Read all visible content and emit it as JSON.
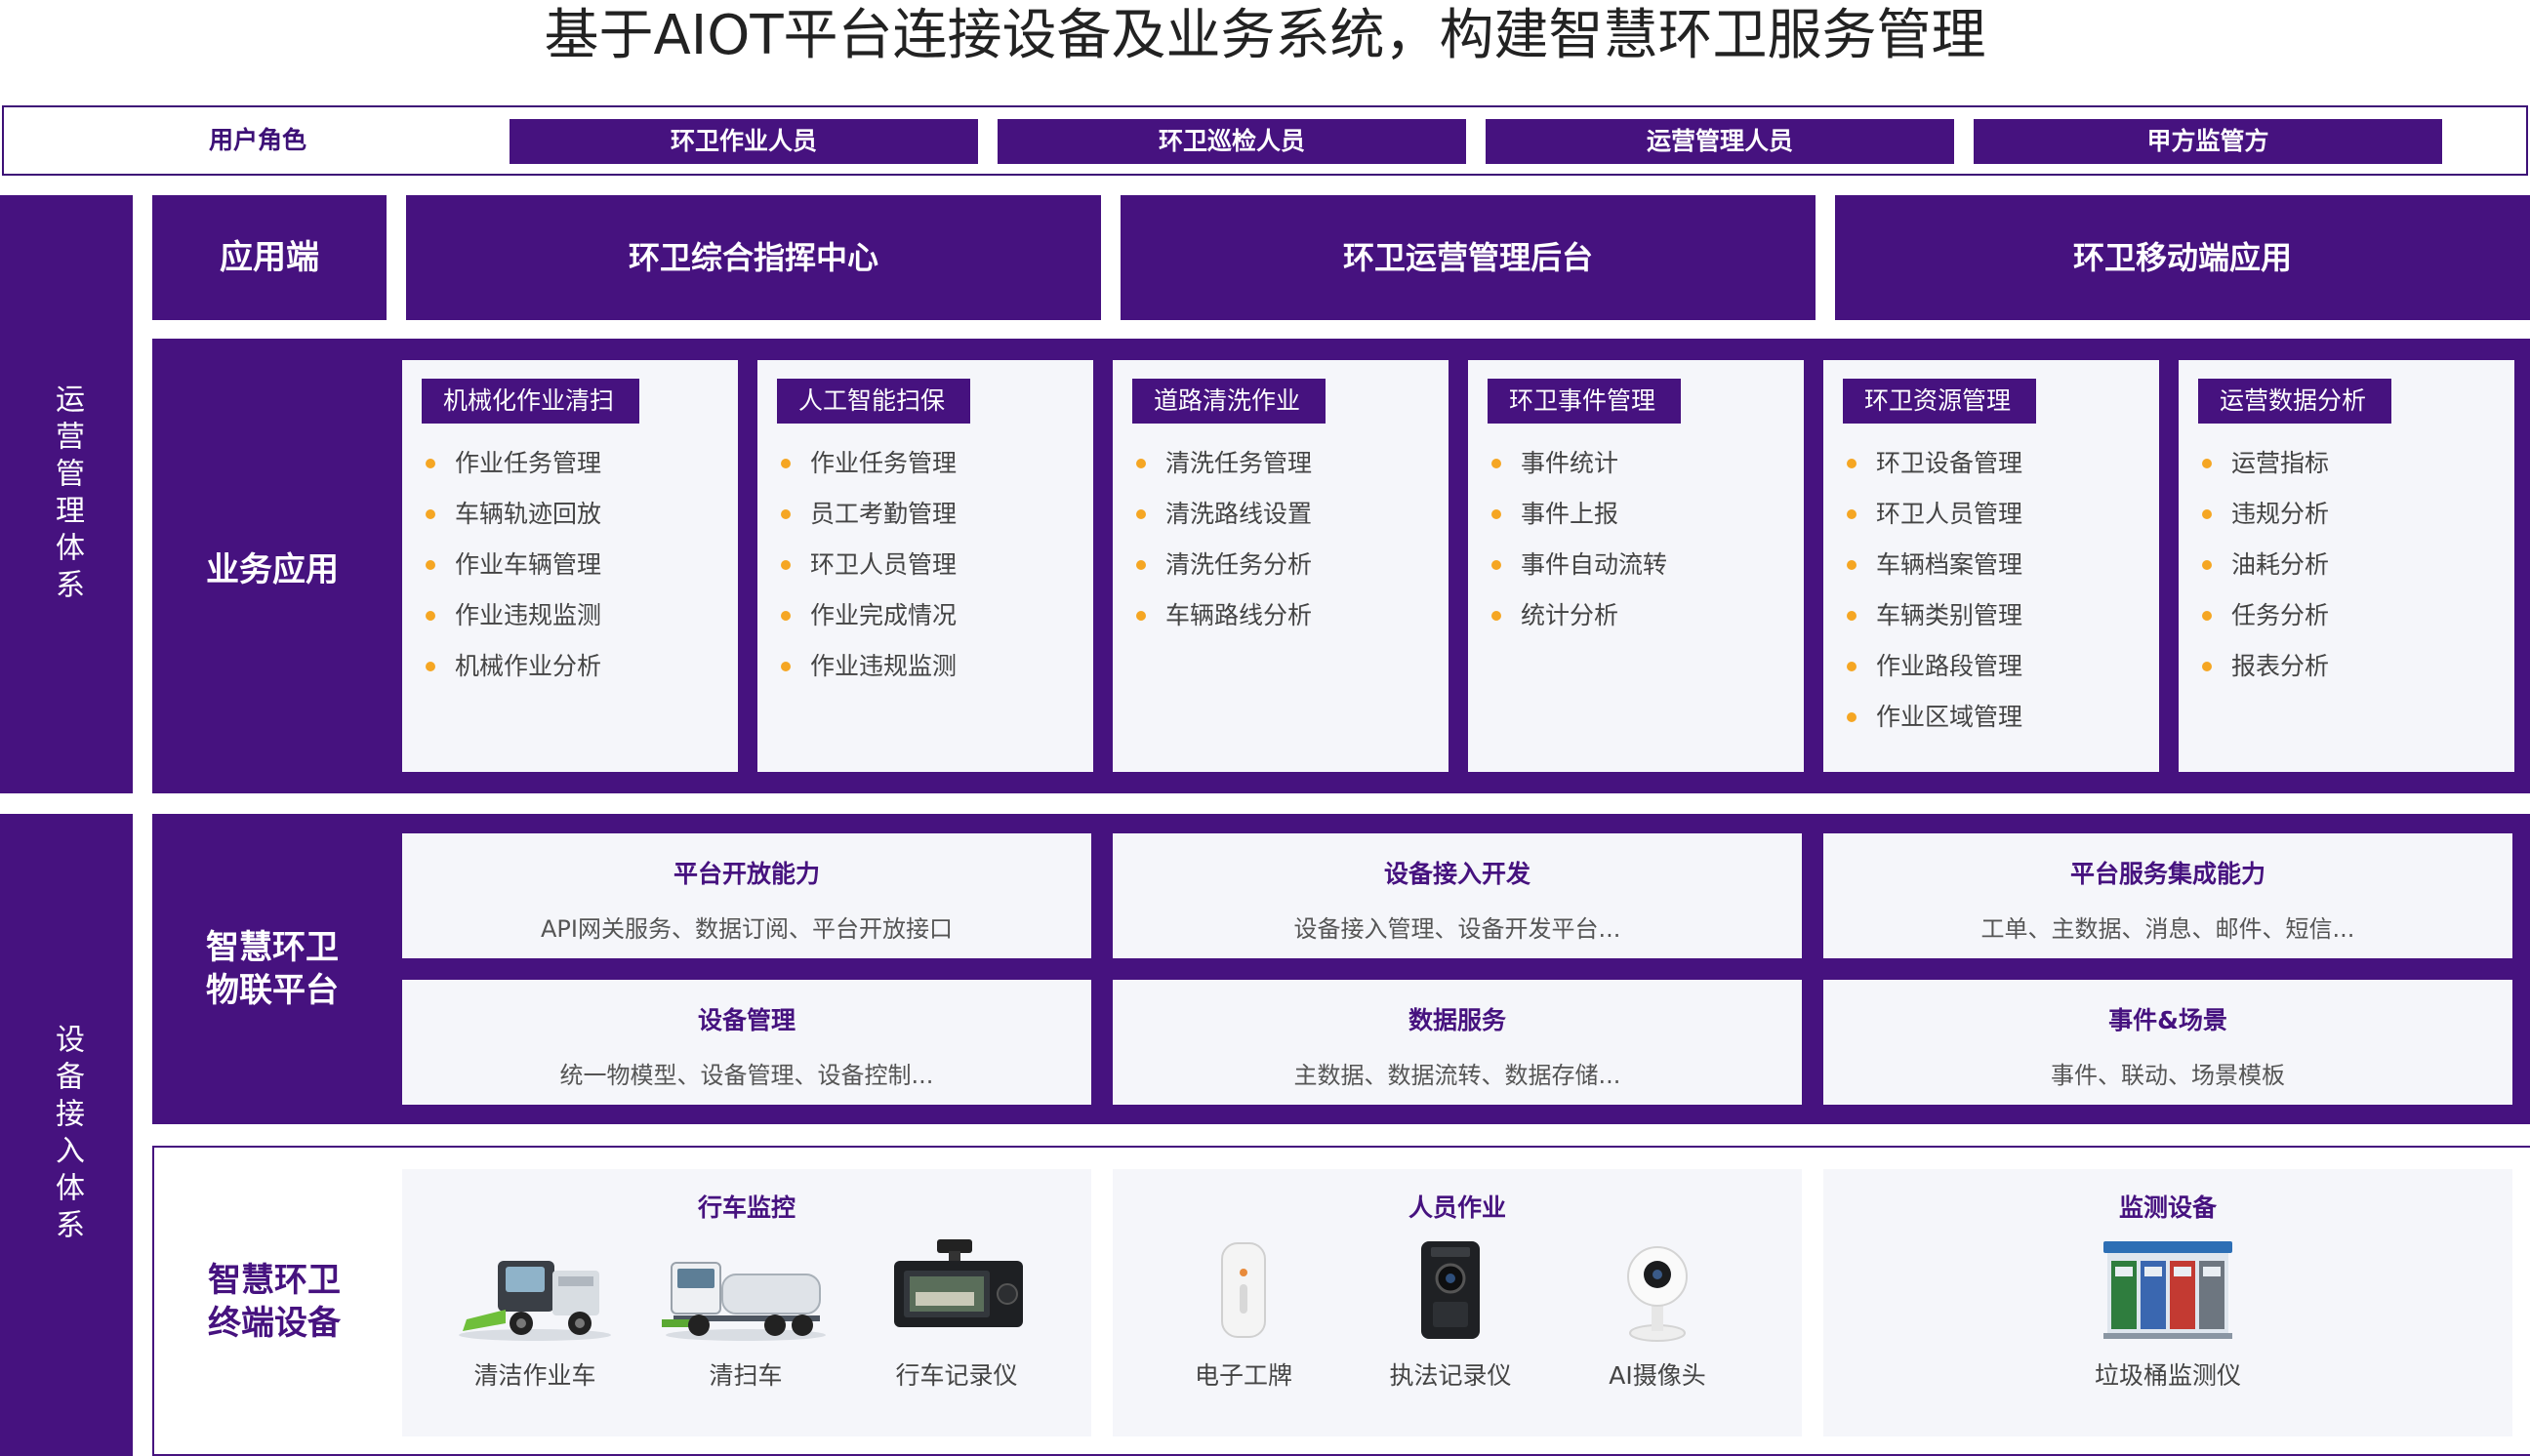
{
  "title": "基于AIOT平台连接设备及业务系统，构建智慧环卫服务管理",
  "roles": {
    "label": "用户角色",
    "items": [
      "环卫作业人员",
      "环卫巡检人员",
      "运营管理人员",
      "甲方监管方"
    ]
  },
  "side": {
    "ops": "运营管理体系",
    "device": "设备接入体系"
  },
  "app": {
    "label": "应用端",
    "items": [
      "环卫综合指挥中心",
      "环卫运营管理后台",
      "环卫移动端应用"
    ]
  },
  "business": {
    "label": "业务应用",
    "cards": [
      {
        "tag": "机械化作业清扫",
        "items": [
          "作业任务管理",
          "车辆轨迹回放",
          "作业车辆管理",
          "作业违规监测",
          "机械作业分析"
        ]
      },
      {
        "tag": "人工智能扫保",
        "items": [
          "作业任务管理",
          "员工考勤管理",
          "环卫人员管理",
          "作业完成情况",
          "作业违规监测"
        ]
      },
      {
        "tag": "道路清洗作业",
        "items": [
          "清洗任务管理",
          "清洗路线设置",
          "清洗任务分析",
          "车辆路线分析"
        ]
      },
      {
        "tag": "环卫事件管理",
        "items": [
          "事件统计",
          "事件上报",
          "事件自动流转",
          "统计分析"
        ]
      },
      {
        "tag": "环卫资源管理",
        "items": [
          "环卫设备管理",
          "环卫人员管理",
          "车辆档案管理",
          "车辆类别管理",
          "作业路段管理",
          "作业区域管理"
        ]
      },
      {
        "tag": "运营数据分析",
        "items": [
          "运营指标",
          "违规分析",
          "油耗分析",
          "任务分析",
          "报表分析"
        ]
      }
    ]
  },
  "iot": {
    "label_line1": "智慧环卫",
    "label_line2": "物联平台",
    "cards": [
      {
        "title": "平台开放能力",
        "desc": "API网关服务、数据订阅、平台开放接口"
      },
      {
        "title": "设备接入开发",
        "desc": "设备接入管理、设备开发平台..."
      },
      {
        "title": "平台服务集成能力",
        "desc": "工单、主数据、消息、邮件、短信..."
      },
      {
        "title": "设备管理",
        "desc": "统一物模型、设备管理、设备控制..."
      },
      {
        "title": "数据服务",
        "desc": "主数据、数据流转、数据存储..."
      },
      {
        "title": "事件&场景",
        "desc": "事件、联动、场景模板"
      }
    ]
  },
  "terminal": {
    "label_line1": "智慧环卫",
    "label_line2": "终端设备",
    "groups": [
      {
        "title": "行车监控",
        "devices": [
          "清洁作业车",
          "清扫车",
          "行车记录仪"
        ]
      },
      {
        "title": "人员作业",
        "devices": [
          "电子工牌",
          "执法记录仪",
          "AI摄像头"
        ]
      },
      {
        "title": "监测设备",
        "devices": [
          "垃圾桶监测仪"
        ]
      }
    ]
  },
  "colors": {
    "brand": "#46127f",
    "bullet": "#f5a623",
    "card": "#f5f6fa"
  }
}
